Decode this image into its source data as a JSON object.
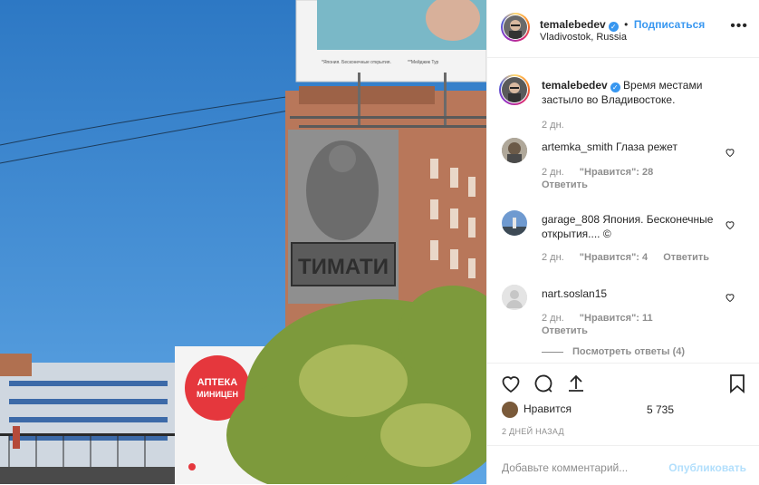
{
  "post": {
    "author": "temalebedev",
    "follow_label": "Подписаться",
    "separator": "•",
    "location": "Vladivostok, Russia",
    "more_label": "•••",
    "caption": "Время местами застыло во Владивостоке.",
    "caption_time": "2 дн."
  },
  "photo": {
    "billboard_text": "ТИМАТИ",
    "pharmacy_line1": "АПТЕКА",
    "pharmacy_line2": "МИНИЦЕН",
    "top_ad_small1": "*Япония. Бесконечные открытия.",
    "top_ad_small2": "**Мейджик Тур"
  },
  "comments": [
    {
      "user": "artemka_smith",
      "text": "Глаза режет",
      "time": "2 дн.",
      "likes": "\"Нравится\": 28",
      "reply": "Ответить"
    },
    {
      "user": "garage_808",
      "text": "Япония. Бесконечные открытия.... ©",
      "time": "2 дн.",
      "likes": "\"Нравится\": 4",
      "reply": "Ответить"
    },
    {
      "user": "nart.soslan15",
      "text": "",
      "time": "2 дн.",
      "likes": "\"Нравится\": 11",
      "reply": "Ответить"
    }
  ],
  "view_replies": "Посмотреть ответы (4)",
  "likes_label": "Нравится",
  "likes_count": "5 735",
  "post_date": "2 ДНЕЙ НАЗАД",
  "add_comment_placeholder": "Добавьте комментарий...",
  "publish_label": "Опубликовать"
}
